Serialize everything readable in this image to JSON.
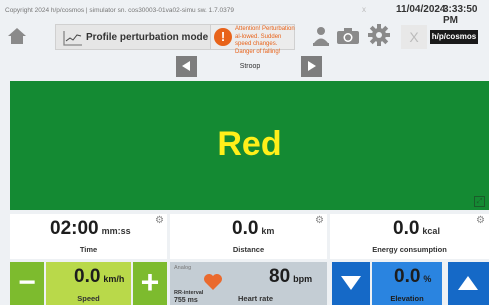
{
  "header": {
    "copyright": "Copyright 2024 h/p/cosmos | simulator sn. cos30003-01va02-simu sw. 1.7.0379",
    "small_x": "x",
    "date": "11/04/2024",
    "time": "3:33:50 PM"
  },
  "toolbar": {
    "mode_label": "Profile perturbation mode",
    "warning_icon": "!",
    "warning_text": "Attention! Perturbation al-lowed. Sudden speed changes. Danger of falling!",
    "close_label": "X",
    "logo_text": "h/p/cosmos"
  },
  "navigator": {
    "label": "Stroop"
  },
  "stroop": {
    "word": "Red",
    "word_color": "#ffef1a",
    "background": "#148a33"
  },
  "tiles": {
    "time": {
      "value": "02:00",
      "unit": "mm:ss",
      "label": "Time"
    },
    "distance": {
      "value": "0.0",
      "unit": "km",
      "label": "Distance"
    },
    "energy": {
      "value": "0.0",
      "unit": "kcal",
      "label": "Energy consumption"
    }
  },
  "speed": {
    "minus": "−",
    "value": "0.0",
    "unit": "km/h",
    "label": "Speed",
    "plus": "+"
  },
  "heart": {
    "analog_label": "Analog",
    "value": "80",
    "unit": "bpm",
    "label": "Heart rate",
    "rr_label": "RR-interval",
    "rr_value": "755 ms"
  },
  "elevation": {
    "value": "0.0",
    "unit": "%",
    "label": "Elevation"
  },
  "icons": {
    "home": "home-icon",
    "chart": "chart-icon",
    "warning": "warning-icon",
    "user": "user-icon",
    "camera": "camera-icon",
    "gear": "gear-icon",
    "heart": "heart-icon",
    "down": "arrow-down-icon",
    "up": "arrow-up-icon"
  }
}
